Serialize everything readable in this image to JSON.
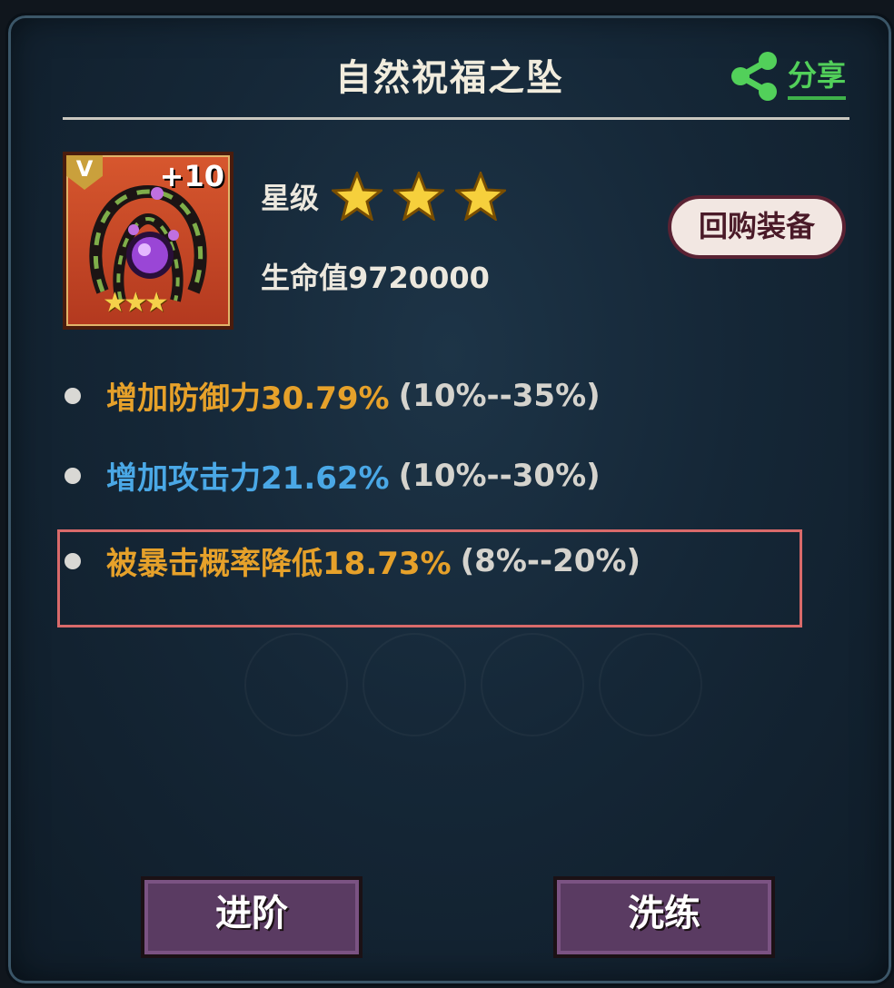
{
  "panel": {
    "title": "自然祝福之坠"
  },
  "share": {
    "label": "分享",
    "icon": "share-icon"
  },
  "item": {
    "badge": "V",
    "enhance": "+10",
    "icon_stars": "★★★",
    "star_label": "星级",
    "stars": 3,
    "hp_label": "生命值9720000"
  },
  "buyback_label": "回购装备",
  "stats": [
    {
      "text": "增加防御力30.79%",
      "range": "(10%--35%)",
      "color": "#e6a12a"
    },
    {
      "text": "增加攻击力21.62%",
      "range": "(10%--30%)",
      "color": "#4aa8e6"
    },
    {
      "text": "被暴击概率降低18.73%",
      "range": "(8%--20%)",
      "color": "#e6a12a"
    }
  ],
  "buttons": {
    "advance": "进阶",
    "refine": "洗练"
  },
  "colors": {
    "accent_gold": "#e6a12a",
    "accent_blue": "#4aa8e6",
    "share_green": "#52d05a",
    "highlight_red": "#d96a6a"
  }
}
